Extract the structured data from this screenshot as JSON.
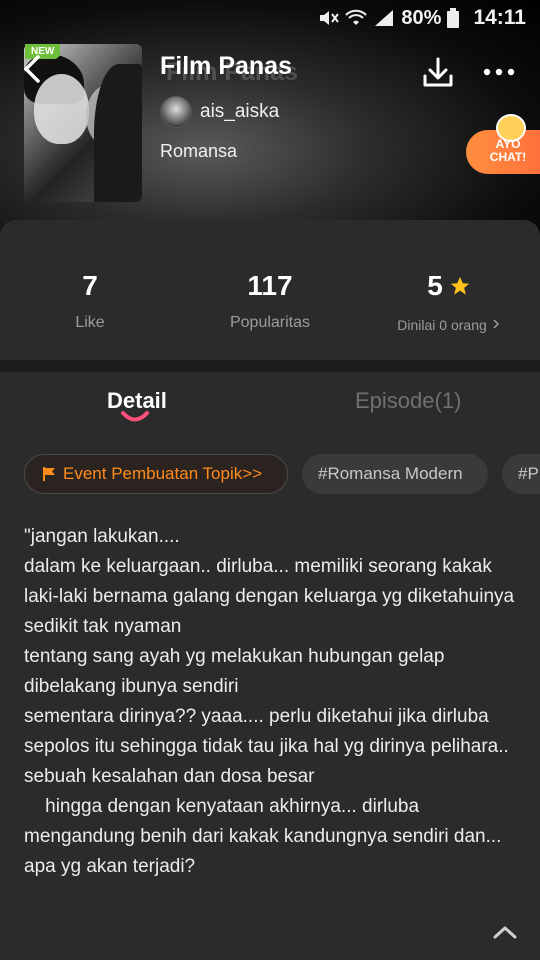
{
  "status_bar": {
    "battery": "80%",
    "time": "14:11",
    "icons": [
      "mute-icon",
      "wifi-icon",
      "signal-icon",
      "battery-icon"
    ]
  },
  "header": {
    "badge": "NEW",
    "title": "Film Panas",
    "author": "ais_aiska",
    "genre": "Romansa"
  },
  "ayo_chat": {
    "label": "AYO CHAT!"
  },
  "stats": {
    "like_value": "7",
    "like_label": "Like",
    "popularity_value": "117",
    "popularity_label": "Popularitas",
    "rating_value": "5",
    "rating_label": "Dinilai 0 orang"
  },
  "tabs": [
    {
      "label": "Detail",
      "active": true
    },
    {
      "label": "Episode(1)",
      "active": false
    }
  ],
  "chips": {
    "event": "Event Pembuatan Topik>>",
    "tag1": "#Romansa Modern",
    "tag2": "#P"
  },
  "description": "\"jangan lakukan....\ndalam ke keluargaan.. dirluba... memiliki seorang kakak laki-laki bernama galang dengan keluarga yg diketahuinya sedikit tak nyaman\ntentang sang ayah yg melakukan hubungan gelap dibelakang ibunya sendiri\nsementara dirinya?? yaaa.... perlu diketahui jika dirluba sepolos itu sehingga tidak tau jika hal yg dirinya pelihara..\nsebuah kesalahan dan dosa besar\n    hingga dengan kenyataan akhirnya... dirluba mengandung benih dari kakak kandungnya sendiri dan...\napa yg akan terjadi?",
  "colors": {
    "background": "#2b2b2b",
    "accent_orange": "#ff8c1a",
    "indicator_pink": "#ff4f7a",
    "star": "#ffc21a"
  }
}
